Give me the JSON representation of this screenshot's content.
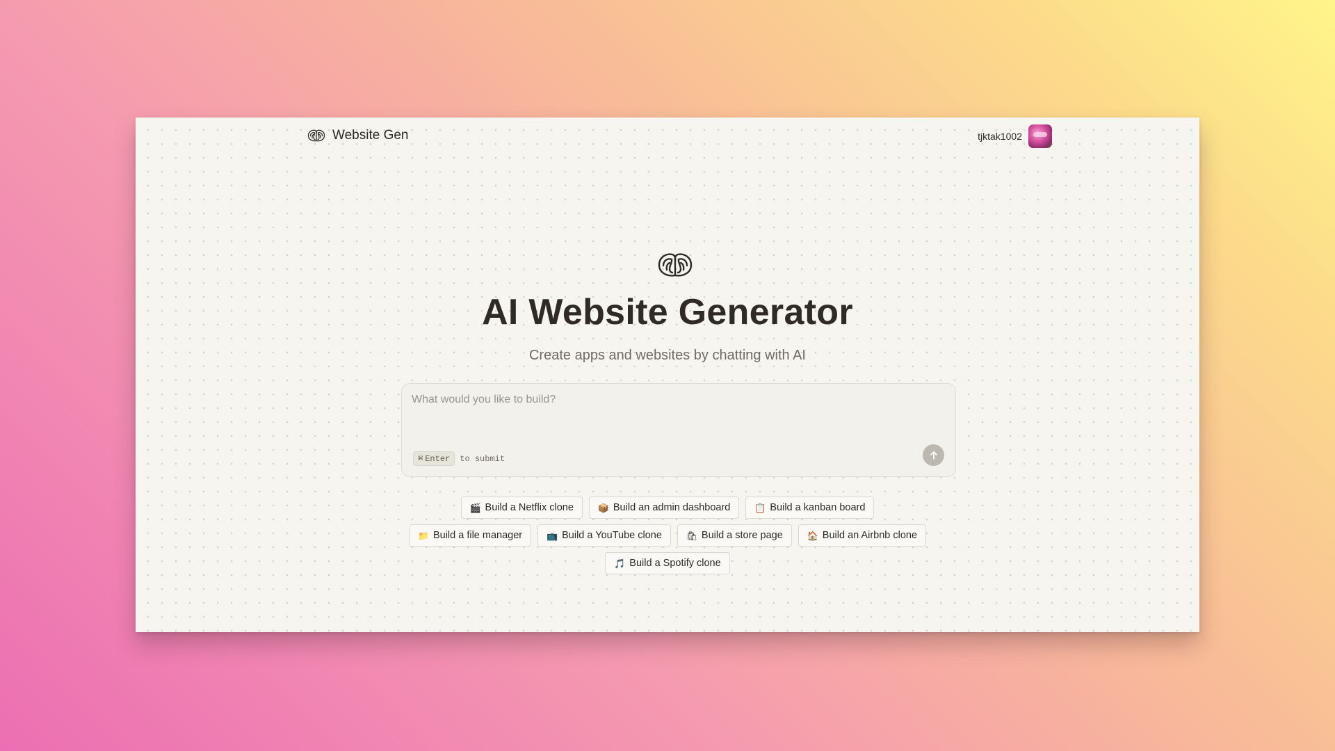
{
  "nav": {
    "brand_name": "Website Gen",
    "username": "tjktak1002"
  },
  "hero": {
    "title": "AI Website Generator",
    "subtitle": "Create apps and websites by chatting with AI"
  },
  "prompt": {
    "placeholder": "What would you like to build?",
    "value": "",
    "shortcut_key": "Enter",
    "shortcut_symbol": "⌘",
    "hint_text": "to submit"
  },
  "suggestions": {
    "row1": [
      {
        "icon": "🎬",
        "icon_name": "clapperboard-icon",
        "label": "Build a Netflix clone"
      },
      {
        "icon": "📦",
        "icon_name": "package-icon",
        "label": "Build an admin dashboard"
      },
      {
        "icon": "📋",
        "icon_name": "clipboard-icon",
        "label": "Build a kanban board"
      }
    ],
    "row2": [
      {
        "icon": "📁",
        "icon_name": "folder-icon",
        "label": "Build a file manager"
      },
      {
        "icon": "📺",
        "icon_name": "tv-icon",
        "label": "Build a YouTube clone"
      },
      {
        "icon": "🛍",
        "icon_name": "shopping-bags-icon",
        "label": "Build a store page"
      },
      {
        "icon": "🏠",
        "icon_name": "house-icon",
        "label": "Build an Airbnb clone"
      }
    ],
    "row3": [
      {
        "icon": "🎵",
        "icon_name": "music-note-icon",
        "label": "Build a Spotify clone"
      }
    ]
  },
  "colors": {
    "window_bg": "#f7f5f0",
    "title": "#2f2b24",
    "subtitle": "#6f6a62",
    "submit_button": "#bcb8b0"
  }
}
